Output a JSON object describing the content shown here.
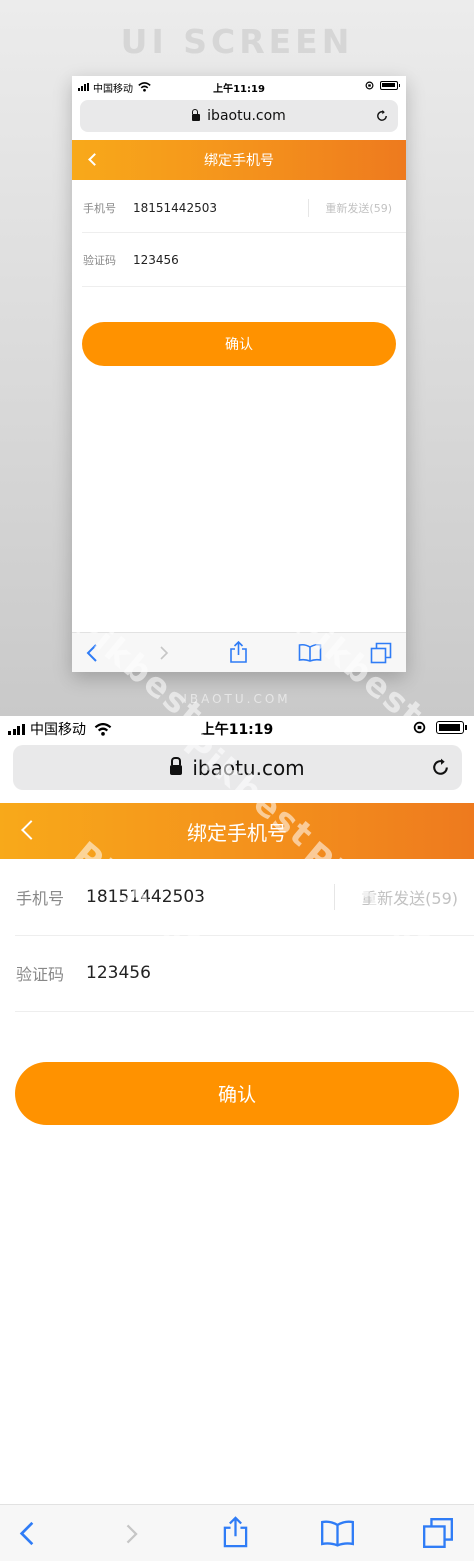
{
  "showcase": {
    "title": "UI SCREEN",
    "footer": "IBAOTU.COM"
  },
  "status_bar": {
    "carrier": "中国移动",
    "time": "上午11:19"
  },
  "browser": {
    "url": "ibaotu.com"
  },
  "page": {
    "title": "绑定手机号",
    "phone_label": "手机号",
    "phone_value": "18151442503",
    "resend_label": "重新发送(59)",
    "code_label": "验证码",
    "code_value": "123456",
    "confirm_label": "确认"
  },
  "toolbar": {
    "items": [
      "back-icon",
      "forward-icon",
      "share-icon",
      "bookmarks-icon",
      "tabs-icon"
    ]
  },
  "watermark": "Pikbest",
  "colors": {
    "accent": "#ff9200",
    "nav_gradient_start": "#f8a91a",
    "nav_gradient_end": "#ee7a1e",
    "toolbar_icon": "#2f7cf6"
  }
}
